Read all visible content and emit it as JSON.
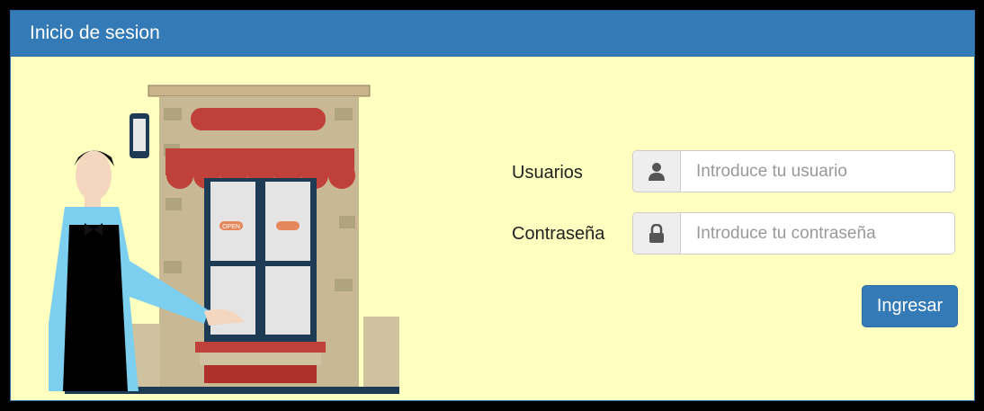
{
  "panel": {
    "title": "Inicio de sesion"
  },
  "illustration": {
    "sign_text": "OPEN"
  },
  "form": {
    "user_label": "Usuarios",
    "user_placeholder": "Introduce tu usuario",
    "user_icon": "user-icon",
    "password_label": "Contraseña",
    "password_placeholder": "Introduce tu contraseña",
    "password_icon": "lock-icon",
    "submit_label": "Ingresar"
  },
  "colors": {
    "header": "#337ab7",
    "panel_bg": "#ffffc0",
    "button": "#337ab7"
  }
}
